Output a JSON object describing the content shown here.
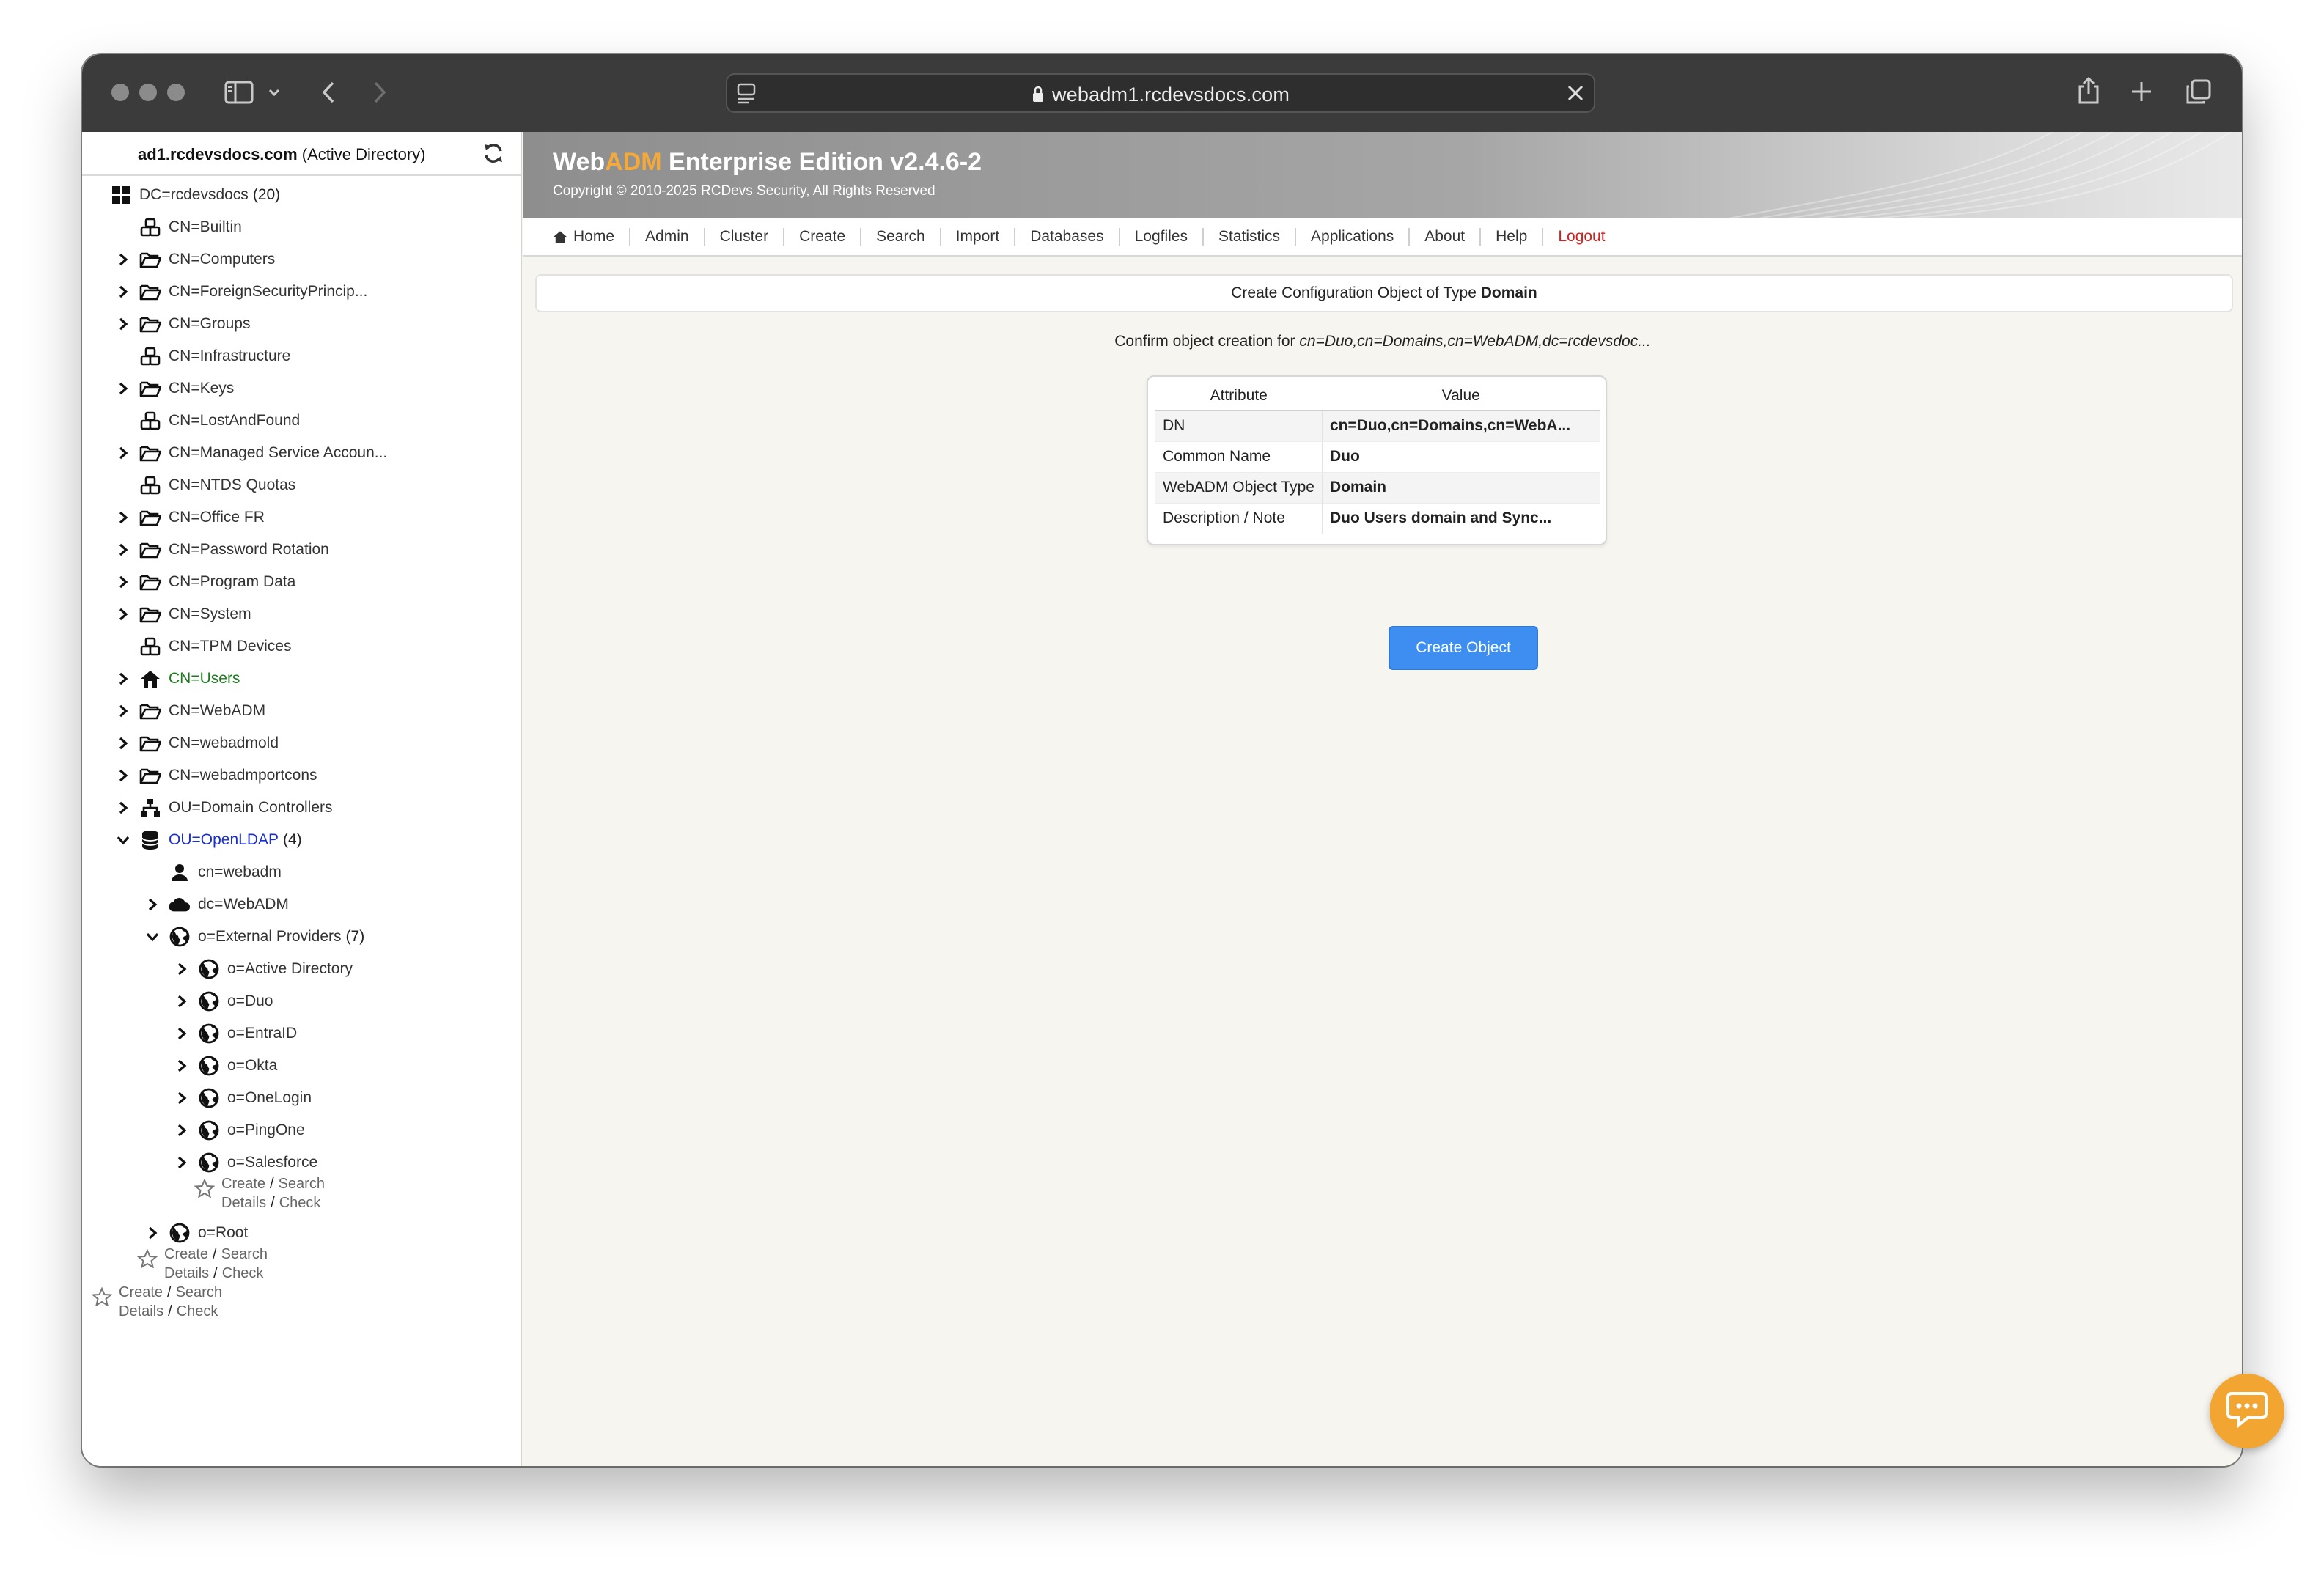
{
  "browser": {
    "url": "webadm1.rcdevsdocs.com"
  },
  "sidebar": {
    "server": "ad1.rcdevsdocs.com",
    "server_type": "(Active Directory)",
    "tree": [
      {
        "label": "DC=rcdevsdocs",
        "count": "(20)",
        "icon": "domain-grid-icon",
        "level": 0,
        "chevron": "none",
        "style": "normal"
      },
      {
        "label": "CN=Builtin",
        "icon": "container-boxes-icon",
        "level": 1,
        "chevron": "none",
        "style": "normal"
      },
      {
        "label": "CN=Computers",
        "icon": "folder-open-icon",
        "level": 1,
        "chevron": "right",
        "style": "normal"
      },
      {
        "label": "CN=ForeignSecurityPrincip...",
        "icon": "folder-open-icon",
        "level": 1,
        "chevron": "right",
        "style": "normal"
      },
      {
        "label": "CN=Groups",
        "icon": "folder-open-icon",
        "level": 1,
        "chevron": "right",
        "style": "normal"
      },
      {
        "label": "CN=Infrastructure",
        "icon": "container-boxes-icon",
        "level": 1,
        "chevron": "none",
        "style": "normal"
      },
      {
        "label": "CN=Keys",
        "icon": "folder-open-icon",
        "level": 1,
        "chevron": "right",
        "style": "normal"
      },
      {
        "label": "CN=LostAndFound",
        "icon": "container-boxes-icon",
        "level": 1,
        "chevron": "none",
        "style": "normal"
      },
      {
        "label": "CN=Managed Service Accoun...",
        "icon": "folder-open-icon",
        "level": 1,
        "chevron": "right",
        "style": "normal"
      },
      {
        "label": "CN=NTDS Quotas",
        "icon": "container-boxes-icon",
        "level": 1,
        "chevron": "none",
        "style": "normal"
      },
      {
        "label": "CN=Office FR",
        "icon": "folder-open-icon",
        "level": 1,
        "chevron": "right",
        "style": "normal"
      },
      {
        "label": "CN=Password Rotation",
        "icon": "folder-open-icon",
        "level": 1,
        "chevron": "right",
        "style": "normal"
      },
      {
        "label": "CN=Program Data",
        "icon": "folder-open-icon",
        "level": 1,
        "chevron": "right",
        "style": "normal"
      },
      {
        "label": "CN=System",
        "icon": "folder-open-icon",
        "level": 1,
        "chevron": "right",
        "style": "normal"
      },
      {
        "label": "CN=TPM Devices",
        "icon": "container-boxes-icon",
        "level": 1,
        "chevron": "none",
        "style": "normal"
      },
      {
        "label": "CN=Users",
        "icon": "home-icon",
        "level": 1,
        "chevron": "right",
        "style": "green"
      },
      {
        "label": "CN=WebADM",
        "icon": "folder-open-icon",
        "level": 1,
        "chevron": "right",
        "style": "normal"
      },
      {
        "label": "CN=webadmold",
        "icon": "folder-open-icon",
        "level": 1,
        "chevron": "right",
        "style": "normal"
      },
      {
        "label": "CN=webadmportcons",
        "icon": "folder-open-icon",
        "level": 1,
        "chevron": "right",
        "style": "normal"
      },
      {
        "label": "OU=Domain Controllers",
        "icon": "org-chart-icon",
        "level": 1,
        "chevron": "right",
        "style": "normal"
      },
      {
        "label": "OU=OpenLDAP",
        "count": "(4)",
        "icon": "database-icon",
        "level": 1,
        "chevron": "down",
        "style": "blue"
      },
      {
        "label": "cn=webadm",
        "icon": "user-icon",
        "level": 2,
        "chevron": "none",
        "style": "normal"
      },
      {
        "label": "dc=WebADM",
        "icon": "cloud-icon",
        "level": 2,
        "chevron": "right",
        "style": "normal"
      },
      {
        "label": "o=External Providers",
        "count": "(7)",
        "icon": "globe-icon",
        "level": 2,
        "chevron": "down",
        "style": "normal"
      },
      {
        "label": "o=Active Directory",
        "icon": "globe-icon",
        "level": 3,
        "chevron": "right",
        "style": "normal"
      },
      {
        "label": "o=Duo",
        "icon": "globe-icon",
        "level": 3,
        "chevron": "right",
        "style": "normal"
      },
      {
        "label": "o=EntraID",
        "icon": "globe-icon",
        "level": 3,
        "chevron": "right",
        "style": "normal"
      },
      {
        "label": "o=Okta",
        "icon": "globe-icon",
        "level": 3,
        "chevron": "right",
        "style": "normal"
      },
      {
        "label": "o=OneLogin",
        "icon": "globe-icon",
        "level": 3,
        "chevron": "right",
        "style": "normal"
      },
      {
        "label": "o=PingOne",
        "icon": "globe-icon",
        "level": 3,
        "chevron": "right",
        "style": "normal"
      },
      {
        "label": "o=Salesforce",
        "icon": "globe-icon",
        "level": 3,
        "chevron": "right",
        "style": "normal"
      }
    ],
    "actions_level3": {
      "create": "Create",
      "search": "Search",
      "details": "Details",
      "check": "Check",
      "sep": "/"
    },
    "root_item": {
      "label": "o=Root",
      "icon": "globe-icon",
      "chevron": "right"
    },
    "actions_level2": {
      "create": "Create",
      "search": "Search",
      "details": "Details",
      "check": "Check",
      "sep": "/"
    },
    "actions_level1": {
      "create": "Create",
      "search": "Search",
      "details": "Details",
      "check": "Check",
      "sep": "/"
    }
  },
  "header": {
    "brand_web": "Web",
    "brand_adm": "ADM",
    "brand_rest": " Enterprise Edition v2.4.6-2",
    "copyright": "Copyright © 2010-2025 RCDevs Security, All Rights Reserved"
  },
  "nav": [
    {
      "label": "Home",
      "icon": "home-icon"
    },
    {
      "label": "Admin"
    },
    {
      "label": "Cluster"
    },
    {
      "label": "Create"
    },
    {
      "label": "Search"
    },
    {
      "label": "Import"
    },
    {
      "label": "Databases"
    },
    {
      "label": "Logfiles"
    },
    {
      "label": "Statistics"
    },
    {
      "label": "Applications"
    },
    {
      "label": "About"
    },
    {
      "label": "Help"
    },
    {
      "label": "Logout",
      "style": "logout"
    }
  ],
  "content": {
    "title_prefix": "Create Configuration Object of Type ",
    "title_type": "Domain",
    "confirm_prefix": "Confirm object creation for ",
    "confirm_dn": "cn=Duo,cn=Domains,cn=WebADM,dc=rcdevsdoc...",
    "table": {
      "headers": [
        "Attribute",
        "Value"
      ],
      "rows": [
        [
          "DN",
          "cn=Duo,cn=Domains,cn=WebA..."
        ],
        [
          "Common Name",
          "Duo"
        ],
        [
          "WebADM Object Type",
          "Domain"
        ],
        [
          "Description / Note",
          "Duo Users domain and Sync..."
        ]
      ]
    },
    "create_button": "Create Object"
  },
  "colors": {
    "accent_orange": "#f4a93a",
    "button_blue": "#3d8ef0",
    "logout_red": "#d22020",
    "users_green": "#1d7d1d",
    "openldap_blue": "#1a2fd1"
  }
}
